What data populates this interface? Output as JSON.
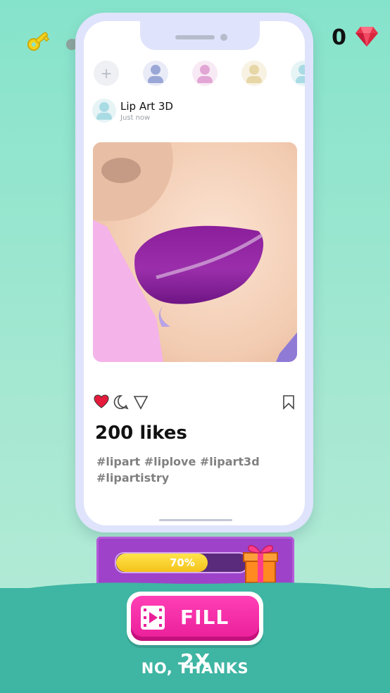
{
  "hud": {
    "keys": [
      {
        "icon": "key-icon",
        "state": "collected",
        "color": "#f5d21d"
      },
      {
        "icon": "key-icon",
        "state": "empty",
        "color": "#8ea59e"
      },
      {
        "icon": "key-icon",
        "state": "empty",
        "color": "#8ea59e"
      }
    ],
    "gem_count": "0",
    "gem_icon": "ruby-gem-icon",
    "gem_color": "#e8364f"
  },
  "phone": {
    "stories": [
      {
        "icon": "add-story-icon",
        "label": "+"
      },
      {
        "icon": "user-avatar-icon",
        "color": "#9aa7d6"
      },
      {
        "icon": "user-avatar-icon",
        "color": "#e2a6d5"
      },
      {
        "icon": "user-avatar-icon",
        "color": "#e7d6a6"
      },
      {
        "icon": "user-avatar-icon",
        "color": "#a9dbe4"
      }
    ],
    "post": {
      "author": "Lip Art 3D",
      "time": "Just now",
      "likes": "200 likes",
      "tags_line1": "#lipart #liplove #lipart3d",
      "tags_line2": "#lipartistry",
      "actions": [
        "heart-icon",
        "comment-icon",
        "share-icon",
        "bookmark-icon"
      ],
      "liked": true,
      "lip_color": "#8d1f9c"
    }
  },
  "progress": {
    "value": 0.7,
    "label": "70%",
    "reward_icon": "gift-box-icon"
  },
  "buttons": {
    "fill_label": "FILL 2X",
    "fill_icon": "video-play-icon",
    "no_thanks_label": "NO, THANKS"
  },
  "colors": {
    "accent_pink": "#e91e98",
    "panel_purple": "#9e43c9",
    "progress_yellow": "#f4c21a",
    "teal": "#3fb5a3"
  }
}
